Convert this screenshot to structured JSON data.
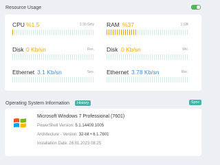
{
  "resource": {
    "title": "Resource Usage",
    "toggle_on": true,
    "cpu": {
      "label": "CPU",
      "value": "%1.5",
      "meta": "2.30 GHz",
      "percent": 1.5
    },
    "ram": {
      "label": "RAM",
      "value": "%37",
      "meta": "1 GB",
      "percent": 37
    },
    "disk_read": {
      "label": "Disk",
      "value": "0 Kb/sn",
      "meta": "Res."
    },
    "disk_write": {
      "label": "Disk",
      "value": "0 Kb/sn",
      "meta": "Wri."
    },
    "eth_send": {
      "label": "Ethernet",
      "value": "3.1 Kb/sn",
      "meta": "Sen."
    },
    "eth_recv": {
      "label": "Ethernet",
      "value": "3.78 Kb/sn",
      "meta": "Rec."
    }
  },
  "os": {
    "title": "Operating System Information",
    "history_label": "History",
    "sync_label": "Sync",
    "name": "Microsoft Windows 7 Professional (7601)",
    "powershell_label": "PowerShell Version:",
    "powershell_value": "5.1.14409.1005",
    "arch_label": "Architecture - Version:",
    "arch_value": "32-bit • 6.1.7601",
    "install_label": "Installation Date:",
    "install_value": "26.01.2023 08:25"
  },
  "colors": {
    "accent_orange": "#f0a800",
    "accent_blue": "#3b8fd6",
    "toggle_green": "#4bbf4e",
    "badge_teal": "#3fb5a8"
  }
}
